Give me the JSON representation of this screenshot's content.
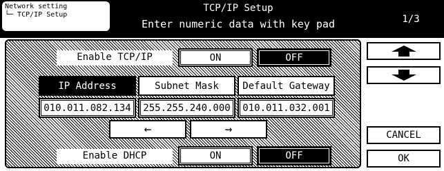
{
  "header": {
    "breadcrumb_parent": "Network setting",
    "breadcrumb_child": "└─ TCP/IP Setup",
    "title": "TCP/IP Setup",
    "instruction": "Enter numeric data with key pad",
    "page_indicator": "1/3"
  },
  "tcpip": {
    "label": "Enable TCP/IP",
    "on_label": "ON",
    "off_label": "OFF",
    "selected": "OFF"
  },
  "tabs": {
    "ip_address": "IP Address",
    "subnet_mask": "Subnet Mask",
    "default_gateway": "Default Gateway",
    "selected": "IP Address"
  },
  "fields": {
    "ip_address": "010.011.082.134",
    "subnet_mask": "255.255.240.000",
    "default_gateway": "010.011.032.001"
  },
  "cursor": {
    "left_arrow": "←",
    "right_arrow": "→"
  },
  "dhcp": {
    "label": "Enable DHCP",
    "on_label": "ON",
    "off_label": "OFF",
    "selected": "OFF"
  },
  "side": {
    "up_icon": "up-arrow-icon",
    "down_icon": "down-arrow-icon",
    "cancel_label": "CANCEL",
    "ok_label": "OK"
  }
}
